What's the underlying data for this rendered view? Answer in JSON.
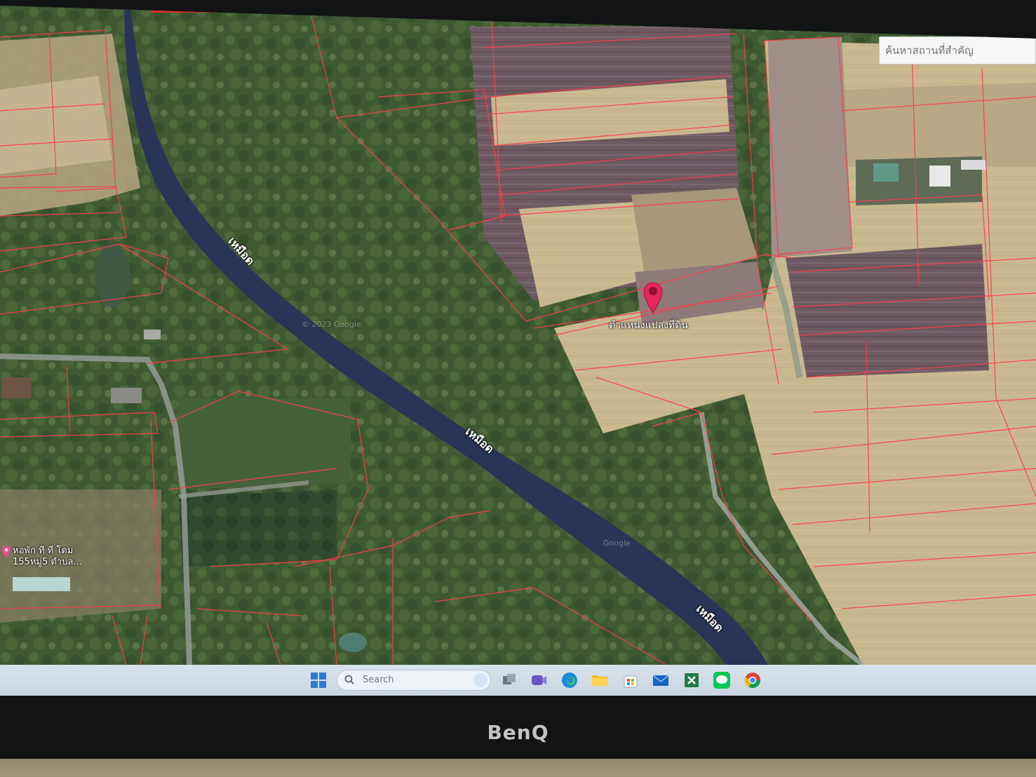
{
  "map": {
    "search_placeholder": "ค้นหาสถานที่สำคัญ",
    "river_labels": [
      "เหมือด",
      "เหมือด",
      "เหมือด"
    ],
    "marker_label": "ตำแหน่งแปลงที่ดิน",
    "poi_label": "หอพัก ที ที โดม\n155หมู่5 ตำบล...",
    "watermark_1": "© 2023 Google",
    "watermark_2": "Google",
    "marker_color": "#e8265e",
    "parcel_line_color": "#ff3b4a",
    "river_color": "#2a3456"
  },
  "taskbar": {
    "search_label": "Search",
    "icons": [
      "windows-start-icon",
      "search-icon",
      "task-view-icon",
      "meet-icon",
      "edge-icon",
      "file-explorer-icon",
      "store-icon",
      "mail-icon",
      "excel-icon",
      "line-icon",
      "chrome-icon"
    ]
  },
  "monitor": {
    "brand": "BenQ"
  }
}
